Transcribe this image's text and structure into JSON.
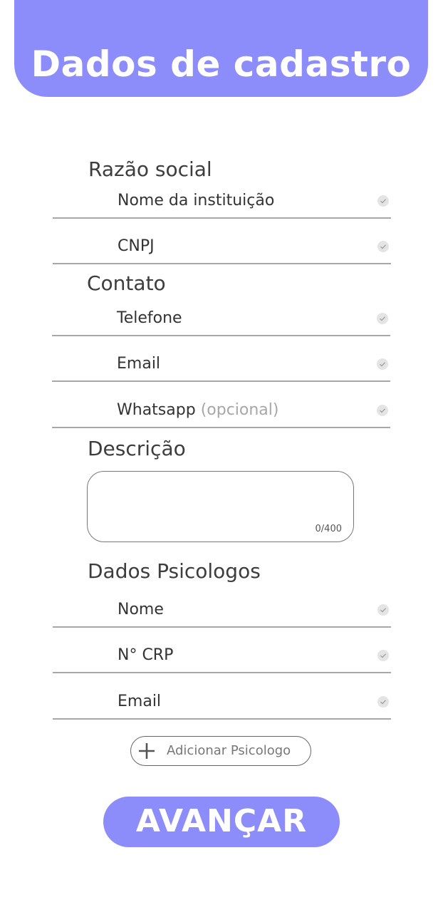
{
  "header": {
    "title": "Dados de cadastro"
  },
  "sections": {
    "razao_social": "Razão social",
    "contato": "Contato",
    "descricao": "Descrição",
    "dados_psicologos": "Dados Psicologos"
  },
  "fields": {
    "nome_instituicao": "Nome da instituição",
    "cnpj": "CNPJ",
    "telefone": "Telefone",
    "email": "Email",
    "whatsapp": "Whatsapp",
    "whatsapp_optional": "(opcional)",
    "psicologo_nome": "Nome",
    "psicologo_crp": "N° CRP",
    "psicologo_email": "Email"
  },
  "description": {
    "counter": "0/400"
  },
  "add_psychologist": {
    "label": "Adicionar Psicologo",
    "icon": "plus-icon"
  },
  "advance_button": {
    "label": "AVANÇAR"
  },
  "colors": {
    "accent": "#8c8cfa",
    "check": "#e4e4e4",
    "line": "#a8a8a8"
  }
}
